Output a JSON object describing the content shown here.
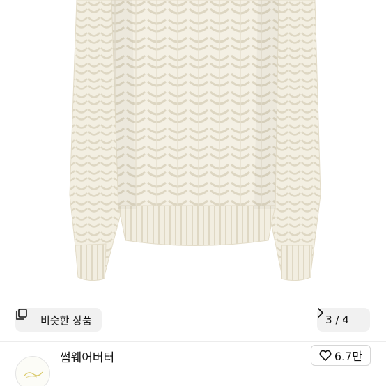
{
  "image_overlay": {
    "similar_items_label": "비슷한 상품",
    "similar_icon": "copy-icon",
    "page_indicator": "3 / 4",
    "next_icon": "chevron-right-icon"
  },
  "seller": {
    "name": "썸웨어버터",
    "avatar_icon": "shop-logo-avatar",
    "like_count": "6.7만",
    "like_icon": "heart-outline-icon"
  },
  "colors": {
    "sweater": "#f3efe3",
    "overlay_bg": "#f0f0f0",
    "text": "#111111"
  }
}
